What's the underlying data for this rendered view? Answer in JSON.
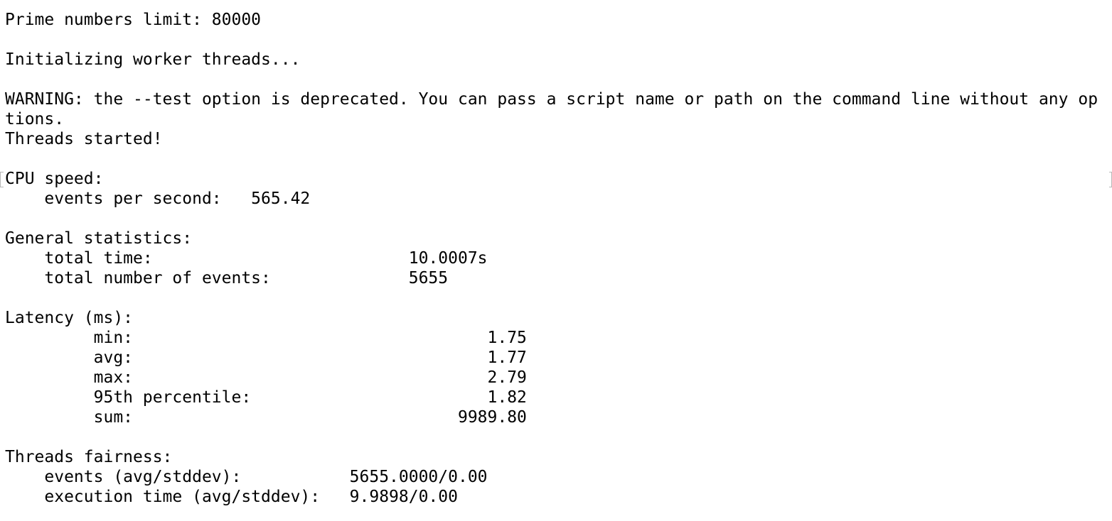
{
  "terminal": {
    "lines": [
      "Prime numbers limit: 80000",
      "",
      "Initializing worker threads...",
      "",
      "WARNING: the --test option is deprecated. You can pass a script name or path on the command line without any op",
      "tions.",
      "Threads started!",
      "",
      "CPU speed:",
      "    events per second:   565.42",
      "",
      "General statistics:",
      "    total time:                          10.0007s",
      "    total number of events:              5655",
      "",
      "Latency (ms):",
      "         min:                                    1.75",
      "         avg:                                    1.77",
      "         max:                                    2.79",
      "         95th percentile:                        1.82",
      "         sum:                                 9989.80",
      "",
      "Threads fairness:",
      "    events (avg/stddev):           5655.0000/0.00",
      "    execution time (avg/stddev):   9.9898/0.00"
    ]
  }
}
